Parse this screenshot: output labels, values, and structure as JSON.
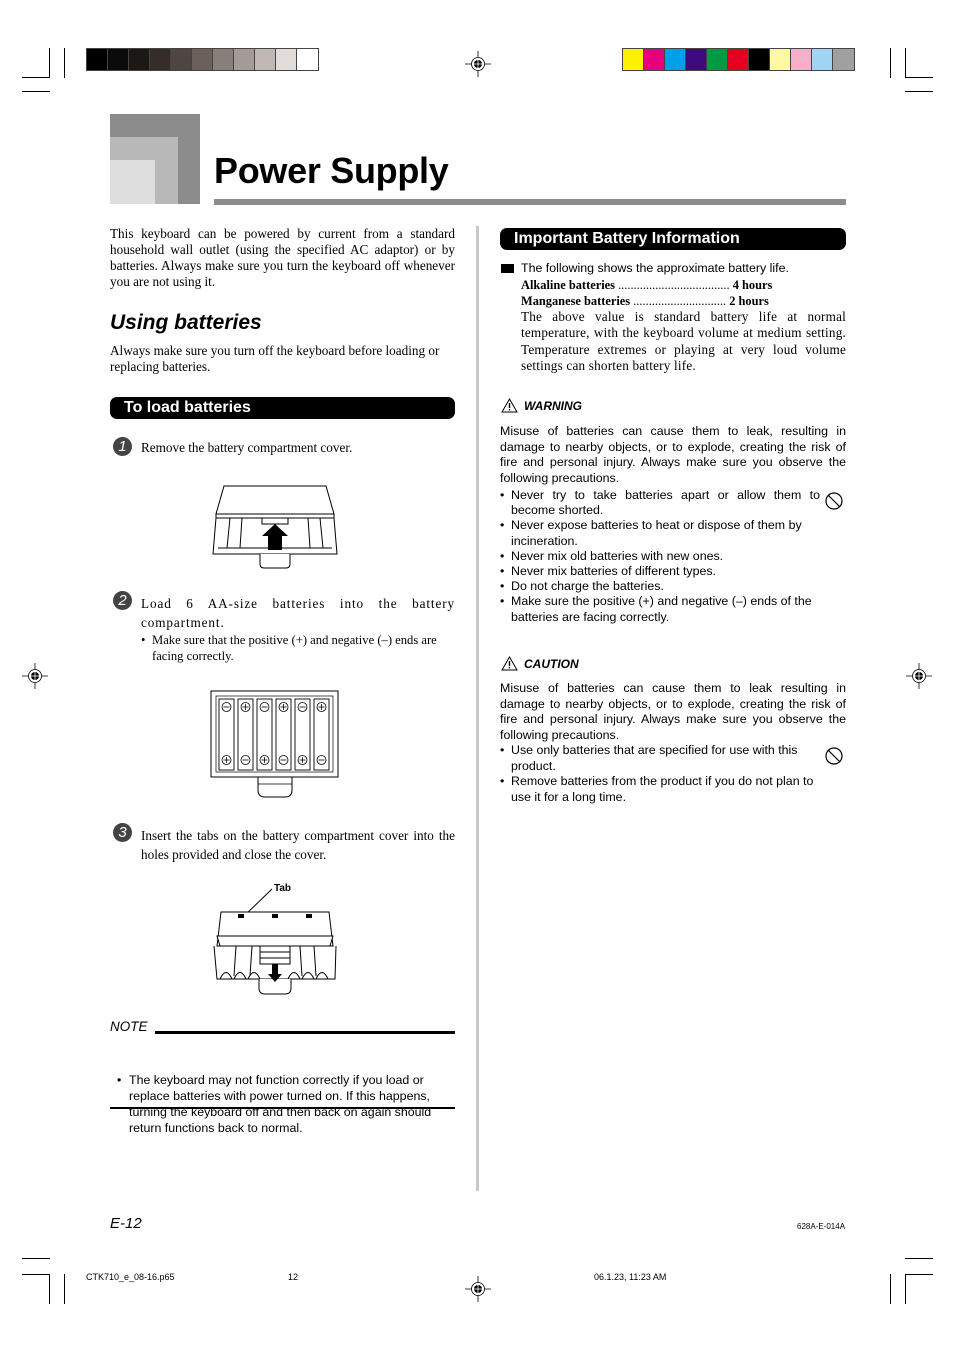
{
  "header": {
    "title": "Power Supply"
  },
  "color_bars": {
    "grayscale": [
      "#000000",
      "#0b0b0b",
      "#1c1815",
      "#352d2a",
      "#504641",
      "#6b605a",
      "#878079",
      "#a29b97",
      "#c0b8b4",
      "#e0dcd9",
      "#ffffff"
    ],
    "colors": [
      "#fff200",
      "#e6007e",
      "#00a0e9",
      "#3d0a7d",
      "#009a44",
      "#e60020",
      "#000000",
      "#fff9a6",
      "#f7afc9",
      "#a0d4f2",
      "#a0a0a0"
    ]
  },
  "left": {
    "intro": "This keyboard can be powered by current from a standard household wall outlet (using the specified AC adaptor) or by batteries. Always make sure you turn the keyboard off whenever you are not using it.",
    "using_heading": "Using batteries",
    "using_text": "Always make sure you turn off the keyboard before loading or replacing batteries.",
    "load_heading": "To load batteries",
    "steps": [
      {
        "num": "1",
        "text": "Remove the battery compartment cover."
      },
      {
        "num": "2",
        "text": "Load 6 AA-size batteries into the battery compartment.",
        "bullet": "Make sure that the positive (+) and negative (–) ends are facing correctly."
      },
      {
        "num": "3",
        "text": "Insert the tabs on the battery compartment cover into the holes provided and close the cover."
      }
    ],
    "tab_label": "Tab",
    "note_label": "NOTE",
    "note_text": "The keyboard may not function correctly if you load or replace batteries with power turned on. If this happens, turning the keyboard off and then back on again should return functions back to normal."
  },
  "right": {
    "info_heading": "Important Battery Information",
    "life_intro": "The following shows the approximate battery life.",
    "life_rows": [
      {
        "label": "Alkaline batteries",
        "dots": "....................................",
        "value": "4 hours"
      },
      {
        "label": "Manganese batteries",
        "dots": "..............................",
        "value": "2 hours"
      }
    ],
    "life_note": "The above value is standard battery life at normal temperature, with the keyboard volume at medium setting. Temperature extremes or playing at very loud volume settings can shorten battery life.",
    "warning_label": "WARNING",
    "warning_text": "Misuse of batteries can cause them to leak, resulting in damage to nearby objects, or to explode, creating the risk of fire and personal injury. Always make sure you observe the following precautions.",
    "warning_items": [
      "Never try to take batteries apart or allow them to become shorted.",
      "Never expose batteries to heat or dispose of them by incineration.",
      "Never mix old batteries with new ones.",
      "Never mix batteries of different types.",
      "Do not charge the batteries.",
      "Make sure the positive (+) and negative (–) ends of the batteries are facing correctly."
    ],
    "caution_label": "CAUTION",
    "caution_text": "Misuse of batteries can cause them to leak resulting in damage to nearby objects, or to explode, creating the risk of fire and personal injury. Always make sure you observe the following precautions.",
    "caution_items": [
      "Use only batteries that are specified for use with this product.",
      "Remove batteries from the product if you do not plan to use it for a long time."
    ]
  },
  "footer": {
    "page_number": "E-12",
    "doc_code": "628A-E-014A",
    "file_name": "CTK710_e_08-16.p65",
    "sheet": "12",
    "timestamp": "06.1.23, 11:23 AM"
  }
}
